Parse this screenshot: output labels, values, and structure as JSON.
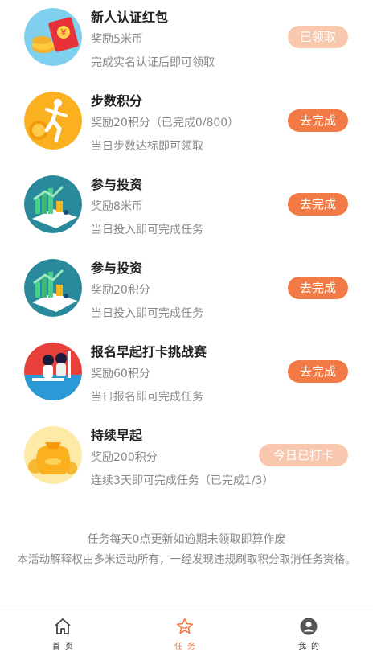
{
  "tasks": [
    {
      "title": "新人认证红包",
      "reward": "奖励5米币",
      "desc": "完成实名认证后即可领取",
      "button": "已领取",
      "state": "done",
      "icon": "red-envelope-icon"
    },
    {
      "title": "步数积分",
      "reward": "奖励20积分（已完成0/800）",
      "desc": "当日步数达标即可领取",
      "button": "去完成",
      "state": "active",
      "icon": "runner-icon"
    },
    {
      "title": "参与投资",
      "reward": "奖励8米币",
      "desc": "当日投入即可完成任务",
      "button": "去完成",
      "state": "active",
      "icon": "investment-chart-icon"
    },
    {
      "title": "参与投资",
      "reward": "奖励20积分",
      "desc": "当日投入即可完成任务",
      "button": "去完成",
      "state": "active",
      "icon": "investment-chart-icon"
    },
    {
      "title": "报名早起打卡挑战赛",
      "reward": "奖励60积分",
      "desc": "当日报名即可完成任务",
      "button": "去完成",
      "state": "active",
      "icon": "challenge-icon"
    },
    {
      "title": "持续早起",
      "reward": "奖励200积分",
      "desc": "连续3天即可完成任务（已完成1/3）",
      "button": "今日已打卡",
      "state": "done",
      "icon": "gold-bag-icon"
    }
  ],
  "footer": {
    "line1": "任务每天0点更新如逾期未领取即算作废",
    "line2": "本活动解释权由多米运动所有，一经发现违规刷取积分取消任务资格。"
  },
  "tabbar": {
    "home": "首页",
    "tasks": "任务",
    "mine": "我的",
    "active_color": "#f27a45"
  },
  "colors": {
    "accent": "#f27a45",
    "accent_light": "#f8c7ae"
  }
}
